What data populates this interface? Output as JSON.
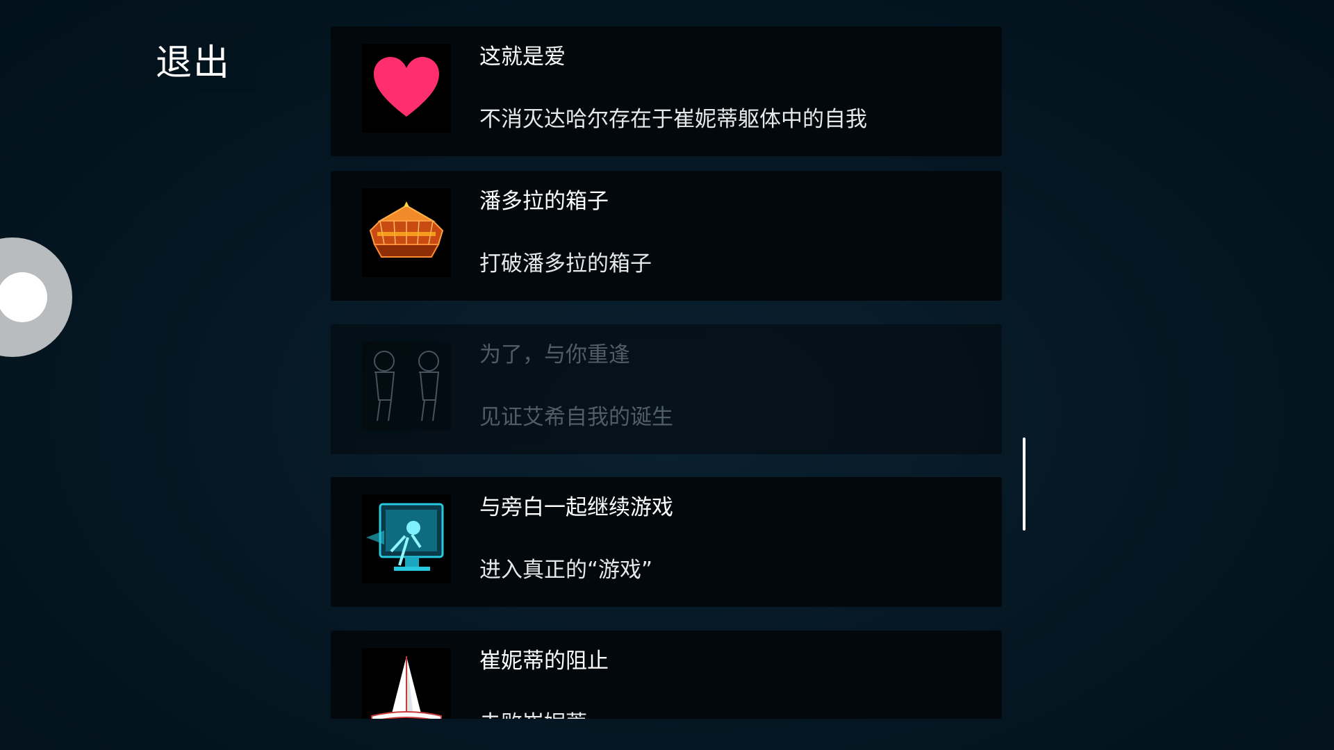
{
  "exit_label": "退出",
  "achievements": [
    {
      "title": "这就是爱",
      "description": "不消灭达哈尔存在于崔妮蒂躯体中的自我",
      "icon": "heart-icon",
      "locked": false
    },
    {
      "title": "潘多拉的箱子",
      "description": "打破潘多拉的箱子",
      "icon": "pandora-box-icon",
      "locked": false
    },
    {
      "title": "为了，与你重逢",
      "description": "见证艾希自我的诞生",
      "icon": "twin-figures-icon",
      "locked": true
    },
    {
      "title": "与旁白一起继续游戏",
      "description": "进入真正的“游戏”",
      "icon": "monitor-icon",
      "locked": false
    },
    {
      "title": "崔妮蒂的阻止",
      "description": "击败崔妮蒂",
      "icon": "spire-icon",
      "locked": false
    }
  ],
  "colors": {
    "background": "#02111b",
    "card": "#03080c",
    "heart": "#ff2f6d",
    "box_orange": "#e8641c",
    "monitor_cyan": "#27c9e0"
  }
}
